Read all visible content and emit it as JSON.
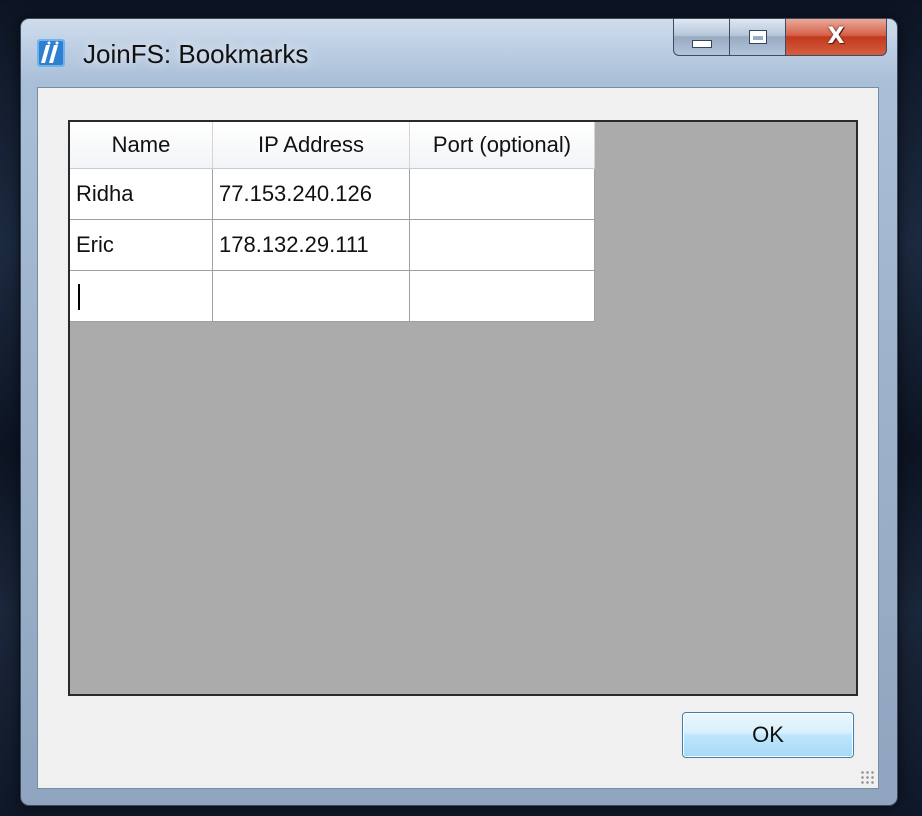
{
  "window": {
    "title": "JoinFS: Bookmarks",
    "icon": "joinfs-app-icon",
    "caption_buttons": {
      "minimize_icon": "minimize-icon",
      "maximize_icon": "maximize-icon",
      "close_icon": "close-icon",
      "close_glyph": "X"
    }
  },
  "grid": {
    "columns": [
      {
        "header": "Name"
      },
      {
        "header": "IP Address"
      },
      {
        "header": "Port (optional)"
      }
    ],
    "rows": [
      {
        "name": "Ridha",
        "ip": "77.153.240.126",
        "port": ""
      },
      {
        "name": "Eric",
        "ip": "178.132.29.111",
        "port": ""
      },
      {
        "name": "",
        "ip": "",
        "port": ""
      }
    ],
    "background_color": "#ababab"
  },
  "buttons": {
    "ok_label": "OK"
  },
  "colors": {
    "close_button": "#c23a1e",
    "ok_button_border": "#3c7fb1",
    "app_icon": "#2f7fd0"
  }
}
